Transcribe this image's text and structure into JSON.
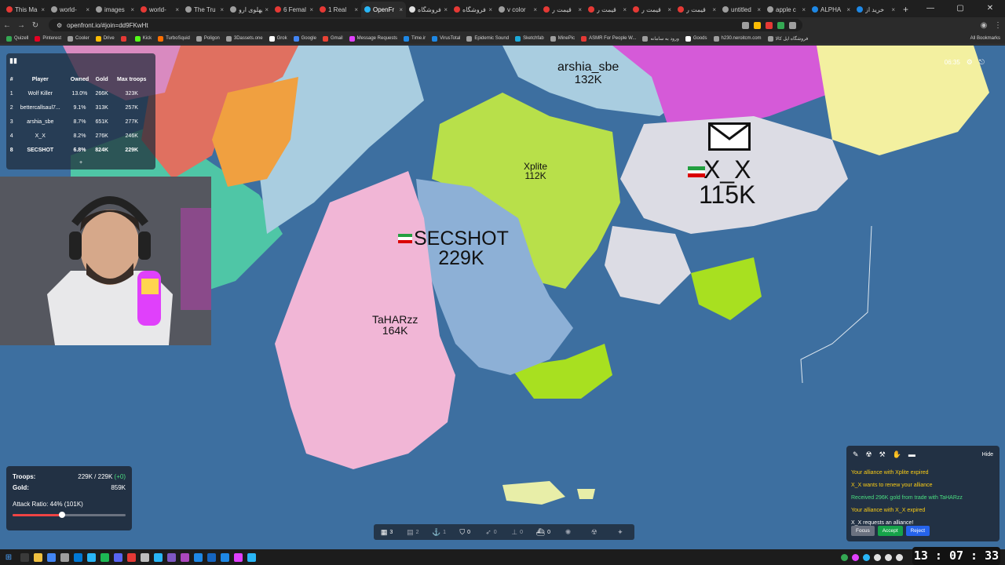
{
  "browser": {
    "tabs": [
      {
        "label": "This Ma",
        "color": "#e53935"
      },
      {
        "label": "world-",
        "color": "#9e9e9e"
      },
      {
        "label": "images",
        "color": "#9e9e9e"
      },
      {
        "label": "world-",
        "color": "#e53935"
      },
      {
        "label": "The Tru",
        "color": "#9e9e9e"
      },
      {
        "label": "پهلوی ارو",
        "color": "#9e9e9e"
      },
      {
        "label": "6 Femal",
        "color": "#e53935"
      },
      {
        "label": "1 Real",
        "color": "#e53935"
      },
      {
        "label": "OpenFr",
        "color": "#29b6f6",
        "active": true
      },
      {
        "label": "فروشگاه",
        "color": "#e0e0e0"
      },
      {
        "label": "فروشگاه",
        "color": "#e53935"
      },
      {
        "label": "v color",
        "color": "#9e9e9e"
      },
      {
        "label": "قیمت ر",
        "color": "#e53935"
      },
      {
        "label": "قیمت ر",
        "color": "#e53935"
      },
      {
        "label": "قیمت ر",
        "color": "#e53935"
      },
      {
        "label": "قیمت ر",
        "color": "#e53935"
      },
      {
        "label": "untitled",
        "color": "#9e9e9e"
      },
      {
        "label": "apple c",
        "color": "#9e9e9e"
      },
      {
        "label": "ALPHA",
        "color": "#1e88e5"
      },
      {
        "label": "خرید از",
        "color": "#1e88e5"
      }
    ],
    "url": "openfront.io/#join=dd9FKwHt",
    "bookmarks": [
      {
        "label": "Quizell",
        "color": "#34a853"
      },
      {
        "label": "Pinterest",
        "color": "#e60023"
      },
      {
        "label": "Cooler",
        "color": "#9e9e9e"
      },
      {
        "label": "Drive",
        "color": "#fbbc04"
      },
      {
        "label": "",
        "color": "#e53935"
      },
      {
        "label": "Kick",
        "color": "#53fc18"
      },
      {
        "label": "TurboSquid",
        "color": "#ff6f00"
      },
      {
        "label": "Poligon",
        "color": "#9e9e9e"
      },
      {
        "label": "3Dassets.one",
        "color": "#9e9e9e"
      },
      {
        "label": "Grok",
        "color": "#ffffff"
      },
      {
        "label": "Google",
        "color": "#4285f4"
      },
      {
        "label": "Gmail",
        "color": "#ea4335"
      },
      {
        "label": "Message Requests",
        "color": "#e040fb"
      },
      {
        "label": "Time.ir",
        "color": "#1e88e5"
      },
      {
        "label": "VirusTotal",
        "color": "#1e88e5"
      },
      {
        "label": "Epidemic Sound",
        "color": "#9e9e9e"
      },
      {
        "label": "Sketchfab",
        "color": "#1caad9"
      },
      {
        "label": "MinePic",
        "color": "#9e9e9e"
      },
      {
        "label": "ASMR For People W...",
        "color": "#e53935"
      },
      {
        "label": "ورود به سامانه",
        "color": "#9e9e9e"
      },
      {
        "label": "Goods",
        "color": "#ffffff"
      },
      {
        "label": "h230.neroitcm.com",
        "color": "#9e9e9e"
      },
      {
        "label": "فروشگاه اپل کالا",
        "color": "#9e9e9e"
      }
    ],
    "all_bookmarks": "All Bookmarks"
  },
  "game": {
    "timer": "06:35",
    "leaderboard": {
      "headers": {
        "rank": "#",
        "player": "Player",
        "owned": "Owned",
        "gold": "Gold",
        "troops": "Max troops"
      },
      "rows": [
        {
          "rank": "1",
          "player": "Wolf Killer",
          "owned": "13.0%",
          "gold": "266K",
          "troops": "323K"
        },
        {
          "rank": "2",
          "player": "bettercallsaul7...",
          "owned": "9.1%",
          "gold": "313K",
          "troops": "257K"
        },
        {
          "rank": "3",
          "player": "arshia_sbe",
          "owned": "8.7%",
          "gold": "651K",
          "troops": "277K"
        },
        {
          "rank": "4",
          "player": "X_X",
          "owned": "8.2%",
          "gold": "276K",
          "troops": "246K"
        },
        {
          "rank": "8",
          "player": "SECSHOT",
          "owned": "6.8%",
          "gold": "824K",
          "troops": "229K",
          "me": true
        }
      ],
      "more": "+"
    },
    "territories": [
      {
        "name": "arshia_sbe",
        "troops": "132K"
      },
      {
        "name": "Xplite",
        "troops": "112K"
      },
      {
        "name": "X_X",
        "troops": "115K"
      },
      {
        "name": "SECSHOT",
        "troops": "229K"
      },
      {
        "name": "TaHARzz",
        "troops": "164K"
      }
    ],
    "stats": {
      "troops_label": "Troops:",
      "troops_value": "229K / 229K",
      "troops_delta": "(+0)",
      "gold_label": "Gold:",
      "gold_value": "859K",
      "attack_ratio": "Attack Ratio: 44% (101K)",
      "attack_ratio_fraction": 0.44
    },
    "buildbar": [
      {
        "icon": "city-icon",
        "glyph": "▦",
        "count": "3",
        "on": true
      },
      {
        "icon": "factory-icon",
        "glyph": "▤",
        "count": "2",
        "on": false
      },
      {
        "icon": "port-icon",
        "glyph": "⚓",
        "count": "1",
        "on": false
      },
      {
        "icon": "defense-icon",
        "glyph": "⛉",
        "count": "0",
        "on": true
      },
      {
        "icon": "missile-silo-icon",
        "glyph": "➶",
        "count": "0",
        "on": false
      },
      {
        "icon": "sam-icon",
        "glyph": "⊥",
        "count": "0",
        "on": false
      },
      {
        "icon": "warship-icon",
        "glyph": "⛴",
        "count": "0",
        "on": true
      },
      {
        "icon": "atom-bomb-icon",
        "glyph": "✺",
        "count": "",
        "on": false
      },
      {
        "icon": "hydrogen-bomb-icon",
        "glyph": "☢",
        "count": "",
        "on": false
      },
      {
        "icon": "mirv-icon",
        "glyph": "✦",
        "count": "",
        "on": false
      }
    ],
    "events": {
      "hide_label": "Hide",
      "messages": [
        {
          "text": "Your alliance with Xplite expired",
          "color": "yellow"
        },
        {
          "text": "X_X wants to renew your alliance",
          "color": "yellow"
        },
        {
          "text": "Received 296K gold from trade with TaHARzz",
          "color": "green"
        },
        {
          "text": "Your alliance with X_X expired",
          "color": "yellow"
        },
        {
          "text": "X_X requests an alliance!",
          "color": "white"
        }
      ],
      "buttons": {
        "focus": "Focus",
        "accept": "Accept",
        "reject": "Reject"
      }
    }
  },
  "taskbar": {
    "clock": "13 : 07 : 33"
  }
}
